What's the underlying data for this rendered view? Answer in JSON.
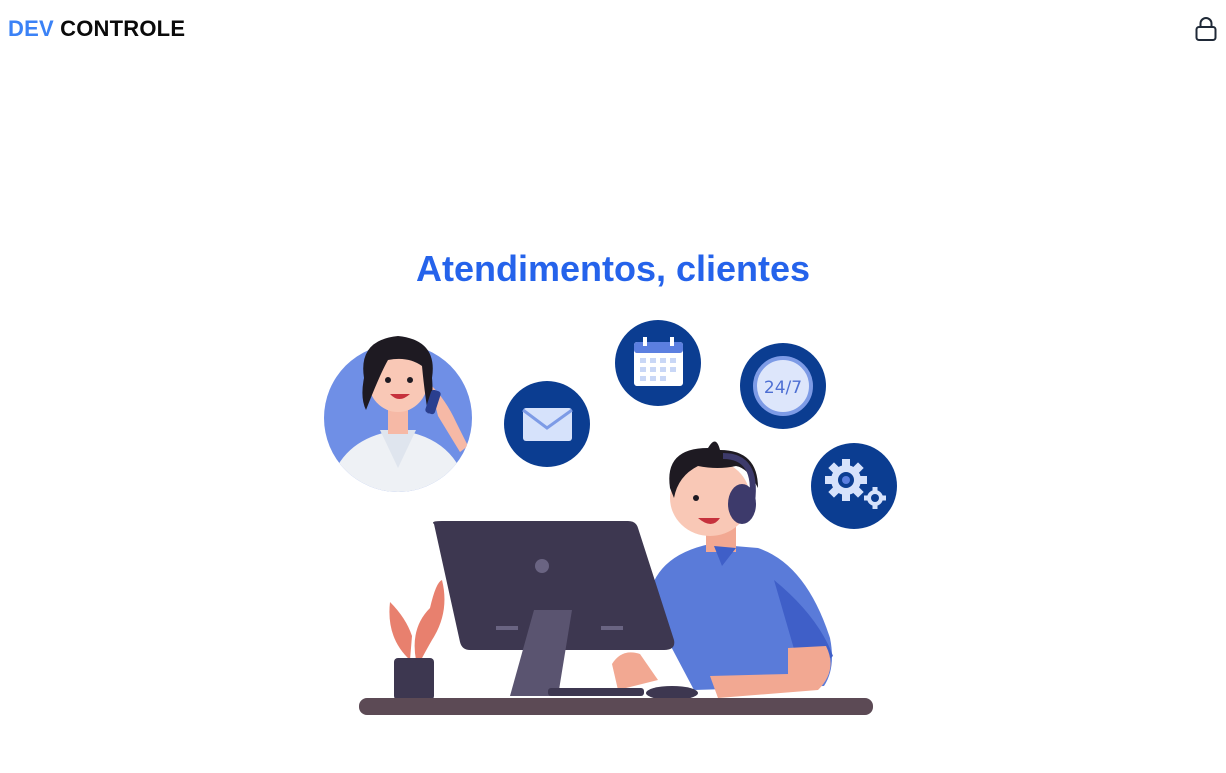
{
  "header": {
    "logo_part1": "DEV",
    "logo_part2": "CONTROLE",
    "login_icon": "lock-icon"
  },
  "hero": {
    "title": "Atendimentos, clientes",
    "illustration_badge_text": "24/7",
    "icons": [
      "envelope-icon",
      "calendar-icon",
      "clock-24-7-icon",
      "gears-icon"
    ]
  },
  "colors": {
    "brand_blue": "#3b82f6",
    "title_blue": "#2563eb",
    "navy_circle": "#0b3d91",
    "monitor": "#3d3750",
    "shirt": "#5a7bd9"
  }
}
